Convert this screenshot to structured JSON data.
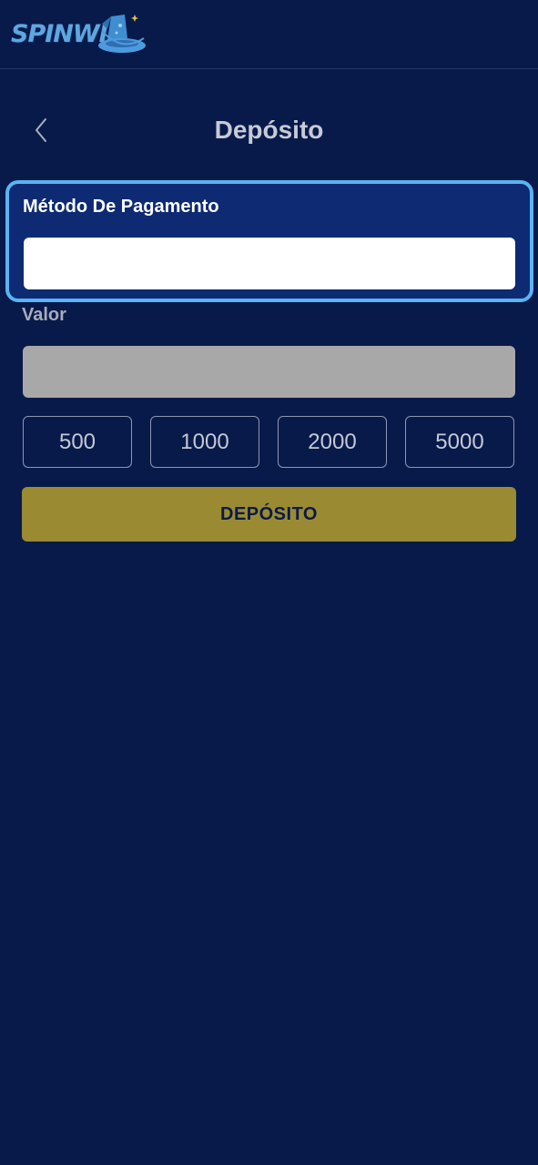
{
  "brand": {
    "logo_text": "SPINWIZ"
  },
  "header": {
    "title": "Depósito"
  },
  "payment_method": {
    "label": "Método De Pagamento",
    "value": ""
  },
  "amount": {
    "label": "Valor",
    "value": ""
  },
  "presets": [
    "500",
    "1000",
    "2000",
    "5000"
  ],
  "submit": {
    "label": "DEPÓSITO"
  },
  "colors": {
    "background": "#081a4a",
    "highlight_border": "#5ab3f2",
    "highlight_bg": "#0d2a72",
    "submit_bg": "#9a8b33",
    "amount_field_bg": "#a8a8a8"
  },
  "icons": {
    "back": "chevron-left-icon",
    "logo_hat": "wizard-hat-icon"
  }
}
